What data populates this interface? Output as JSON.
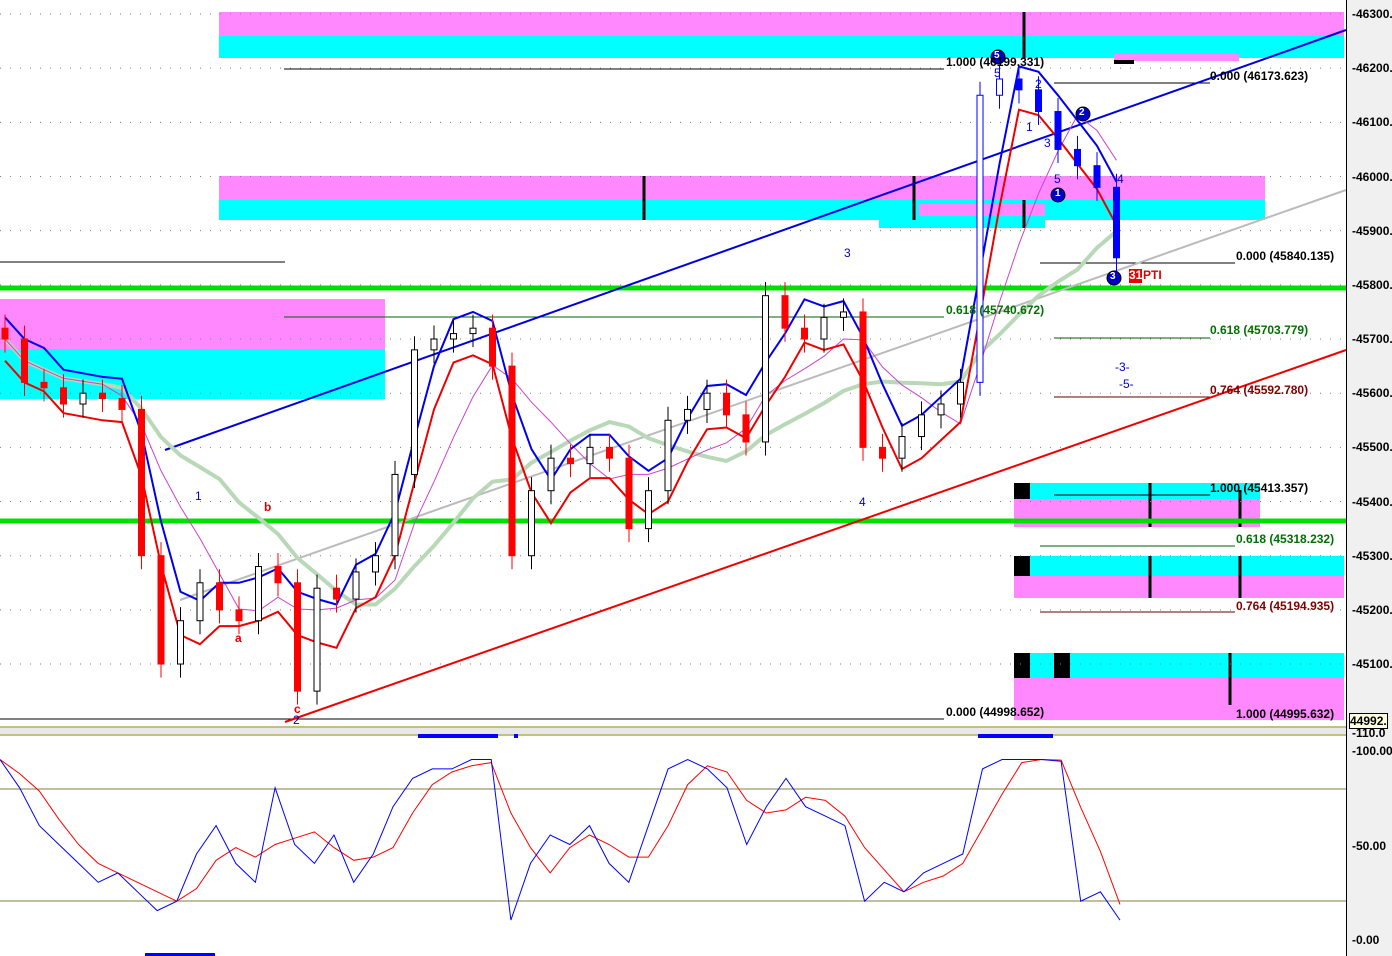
{
  "chart_data": [
    {
      "type": "candlestick",
      "title": "",
      "ylim": [
        44992,
        46320
      ],
      "yticks": [
        "46300.",
        "46200.",
        "46100.",
        "46000.",
        "45900.",
        "45800.",
        "45700.",
        "45600.",
        "45500.",
        "45400.",
        "45300.",
        "45200.",
        "45100."
      ],
      "last_price_label": "44992.",
      "closes": [
        45700,
        45620,
        45610,
        45580,
        45600,
        45590,
        45570,
        45300,
        45100,
        45180,
        45250,
        45200,
        45180,
        45280,
        45250,
        45050,
        45240,
        45220,
        45270,
        45300,
        45450,
        45680,
        45700,
        45710,
        45720,
        45650,
        45300,
        45420,
        45480,
        45470,
        45500,
        45480,
        45350,
        45420,
        45550,
        45570,
        45600,
        45560,
        45510,
        45780,
        45720,
        45700,
        45740,
        45750,
        45500,
        45480,
        45520,
        45560,
        45580,
        45620,
        46150,
        46180,
        46160,
        46120,
        46050,
        46020,
        45980,
        45850
      ],
      "horizontal_levels": [
        45790,
        45370
      ],
      "fib_labels": {
        "f1": "1.000 (46199.331)",
        "f2": "0.000 (46173.623)",
        "f3": "0.000 (45840.135)",
        "f4": "0.618 (45740.672)",
        "f5": "0.618 (45703.779)",
        "f6": "0.764 (45592.780)",
        "f7": "1.000 (45413.357)",
        "f8": "0.618 (45318.232)",
        "f9": "0.764 (45194.935)",
        "f10": "0.000 (44998.652)",
        "f11": "1.000 (44995.632)"
      },
      "wave_labels": {
        "w5": "5",
        "w2": "2",
        "w1": "1",
        "w3": "3",
        "w5b": "5",
        "w3b": "3",
        "w4": "4",
        "w1b": "1",
        "w2b": "2",
        "wm3": "-3-",
        "wm5": "-5-",
        "c4a": "4",
        "c4b": "4",
        "c3": "3"
      },
      "abc_labels": {
        "a": "a",
        "b": "b",
        "c": "c"
      },
      "circle_labels": {
        "c5": "5",
        "c2": "2",
        "c1": "1",
        "c3": "3"
      },
      "marker": {
        "num": "31",
        "text": "PTI"
      }
    },
    {
      "type": "line",
      "title": "Stochastic",
      "ylim": [
        0,
        110
      ],
      "yticks": [
        "110.0",
        "100.00",
        "50.00",
        "0.00"
      ],
      "levels": [
        80,
        20
      ],
      "k": [
        95,
        80,
        60,
        50,
        40,
        30,
        35,
        25,
        15,
        20,
        45,
        60,
        40,
        30,
        80,
        50,
        40,
        55,
        30,
        45,
        70,
        85,
        90,
        90,
        95,
        95,
        10,
        40,
        55,
        50,
        60,
        40,
        30,
        60,
        90,
        95,
        90,
        80,
        50,
        70,
        85,
        70,
        65,
        60,
        20,
        30,
        25,
        35,
        40,
        45,
        90,
        95,
        95,
        95,
        94,
        20,
        25,
        10
      ],
      "colors": {
        "k": "#0000ff",
        "d": "#ff0000"
      }
    }
  ]
}
